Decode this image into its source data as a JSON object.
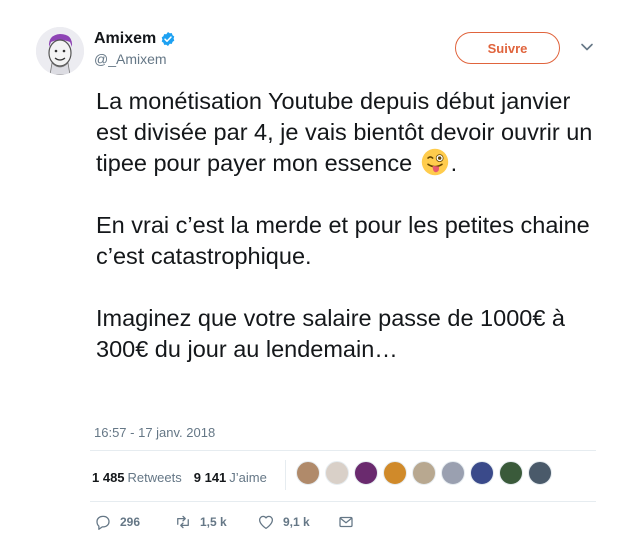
{
  "author": {
    "name": "Amixem",
    "handle": "@_Amixem",
    "verified": true
  },
  "follow_label": "Suivre",
  "tweet": {
    "paragraphs": [
      {
        "before_emoji": "La monétisation Youtube depuis début janvier est divisée par 4, je vais bientôt devoir ouvrir un tipee pour payer mon essence ",
        "emoji": "winking-face-with-tongue",
        "after_emoji": "."
      },
      {
        "text": "En vrai c’est la merde et pour les petites chaine c’est catastrophique."
      },
      {
        "text": "Imaginez que votre salaire passe de 1000€ à 300€ du jour au lendemain…"
      }
    ],
    "timestamp": "16:57 - 17 janv. 2018"
  },
  "stats": {
    "retweets_count": "1 485",
    "retweets_label": "Retweets",
    "likes_count": "9 141",
    "likes_label": "J’aime",
    "likers": [
      {
        "color": "#b08a6a"
      },
      {
        "color": "#d9d0c8"
      },
      {
        "color": "#6a2a6e"
      },
      {
        "color": "#d08a2a"
      },
      {
        "color": "#b8a890"
      },
      {
        "color": "#9aa0b0"
      },
      {
        "color": "#3a4a8a"
      },
      {
        "color": "#3a5a3a"
      },
      {
        "color": "#4a5a6a"
      }
    ]
  },
  "actions": {
    "replies": "296",
    "retweets": "1,5 k",
    "likes": "9,1 k"
  },
  "colors": {
    "accent": "#e0643d",
    "verified": "#1da1f2",
    "muted": "#657786"
  }
}
